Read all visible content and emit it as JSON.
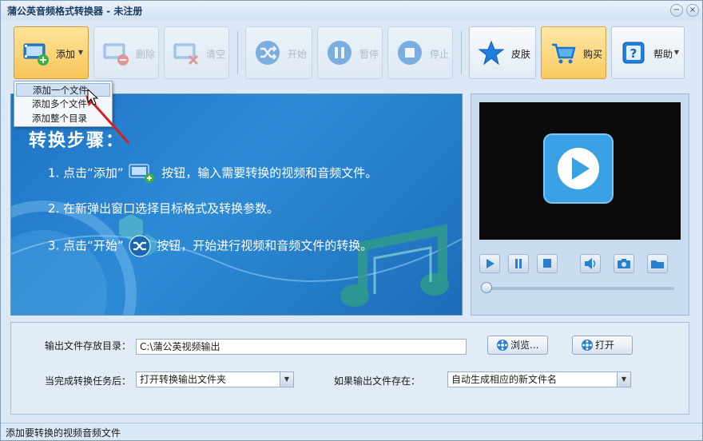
{
  "window": {
    "title": "蒲公英音频格式转换器 - 未注册",
    "minimize_glyph": "−",
    "close_glyph": "×"
  },
  "toolbar": {
    "add_label": "添加",
    "delete_label": "删除",
    "clear_label": "清空",
    "start_label": "开始",
    "pause_label": "暂停",
    "stop_label": "停止",
    "skin_label": "皮肤",
    "buy_label": "购买",
    "help_label": "帮助"
  },
  "add_menu": {
    "items": [
      "添加一个文件",
      "添加多个文件",
      "添加整个目录"
    ],
    "selected_index": 0
  },
  "guide": {
    "heading": "转换步骤：",
    "step1_a": "1. 点击“添加”",
    "step1_b": "按钮，输入需要转换的视频和音频文件。",
    "step2": "2. 在新弹出窗口选择目标格式及转换参数。",
    "step3_a": "3. 点击“开始”",
    "step3_b": "按钮，开始进行视频和音频文件的转换。"
  },
  "player": {
    "progress": 0
  },
  "settings": {
    "output_dir_label": "输出文件存放目录：",
    "output_dir_value": "C:\\蒲公英视频输出",
    "browse_label": "浏览...",
    "open_label": "打开",
    "after_label": "当完成转换任务后：",
    "after_value": "打开转换输出文件夹",
    "exists_label": "如果输出文件存在：",
    "exists_value": "自动生成相应的新文件名"
  },
  "status": {
    "text": "添加要转换的视频音频文件"
  },
  "colors": {
    "accent": "#f8c45a",
    "guide_bg": "#2d8bd6",
    "play_icon": "#3aa0e4"
  }
}
